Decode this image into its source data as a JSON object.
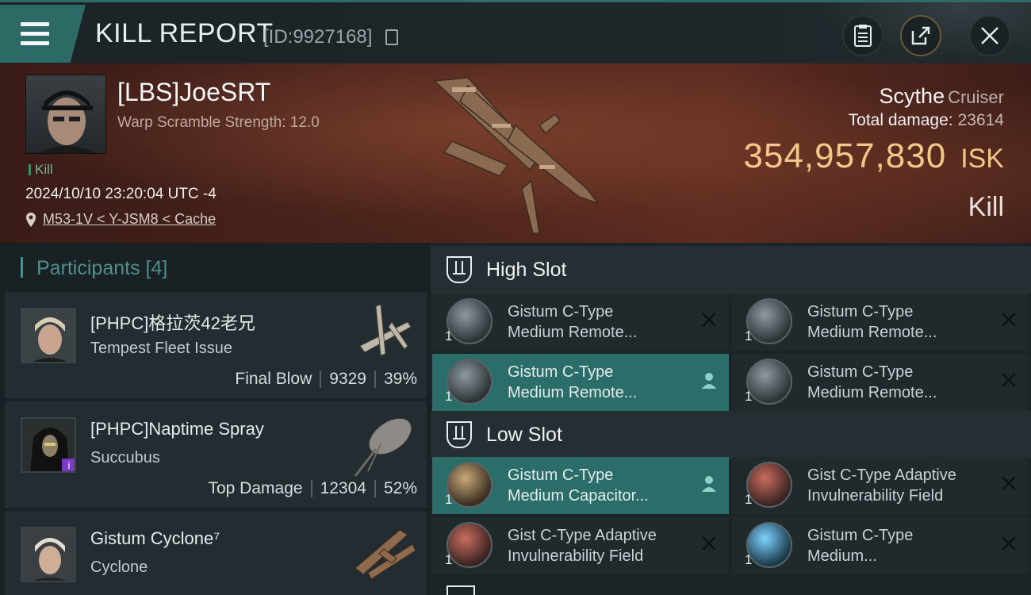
{
  "header": {
    "title": "KILL REPORT",
    "report_id": "[ID:9927168]",
    "icons": [
      "menu-icon",
      "clipboard-icon",
      "share-icon",
      "close-icon"
    ]
  },
  "victim": {
    "name": "[LBS]JoeSRT",
    "warp_scramble": "Warp Scramble Strength: 12.0",
    "tag": "Kill",
    "datetime": "2024/10/10 23:20:04 UTC -4",
    "location": "M53-1V < Y-JSM8 < Cache",
    "ship_name": "Scythe",
    "ship_class": "Cruiser",
    "total_damage_label": "Total damage:",
    "total_damage_value": "23614",
    "isk_value": "354,957,830",
    "isk_unit": "ISK",
    "result": "Kill"
  },
  "participants": {
    "title": "Participants",
    "count": "[4]",
    "items": [
      {
        "name": "[PHPC]格拉茨42老兄",
        "ship": "Tempest Fleet Issue",
        "role": "Final Blow",
        "damage": "9329",
        "percent": "39%"
      },
      {
        "name": "[PHPC]Naptime Spray",
        "ship": "Succubus",
        "role": "Top Damage",
        "damage": "12304",
        "percent": "52%",
        "badge": "i"
      },
      {
        "name": "Gistum Cyclone⁷",
        "ship": "Cyclone"
      }
    ]
  },
  "slots": {
    "high": {
      "label": "High Slot",
      "modules": [
        {
          "qty": "1",
          "line1": "Gistum C-Type",
          "line2": "Medium Remote...",
          "active": false
        },
        {
          "qty": "1",
          "line1": "Gistum C-Type",
          "line2": "Medium Remote...",
          "active": false
        },
        {
          "qty": "1",
          "line1": "Gistum C-Type",
          "line2": "Medium Remote...",
          "active": true
        },
        {
          "qty": "1",
          "line1": "Gistum C-Type",
          "line2": "Medium Remote...",
          "active": false
        }
      ]
    },
    "low": {
      "label": "Low Slot",
      "modules": [
        {
          "qty": "1",
          "line1": "Gistum C-Type",
          "line2": "Medium Capacitor...",
          "active": true
        },
        {
          "qty": "1",
          "line1": "Gist C-Type Adaptive",
          "line2": "Invulnerability Field",
          "active": false
        },
        {
          "qty": "1",
          "line1": "Gist C-Type Adaptive",
          "line2": "Invulnerability Field",
          "active": false
        },
        {
          "qty": "1",
          "line1": "Gistum C-Type",
          "line2": "Medium...",
          "active": false
        }
      ]
    }
  },
  "colors": {
    "accent_teal": "#2e6a65",
    "isk_gold": "#f3c889",
    "active_module": "#2b6e69"
  }
}
